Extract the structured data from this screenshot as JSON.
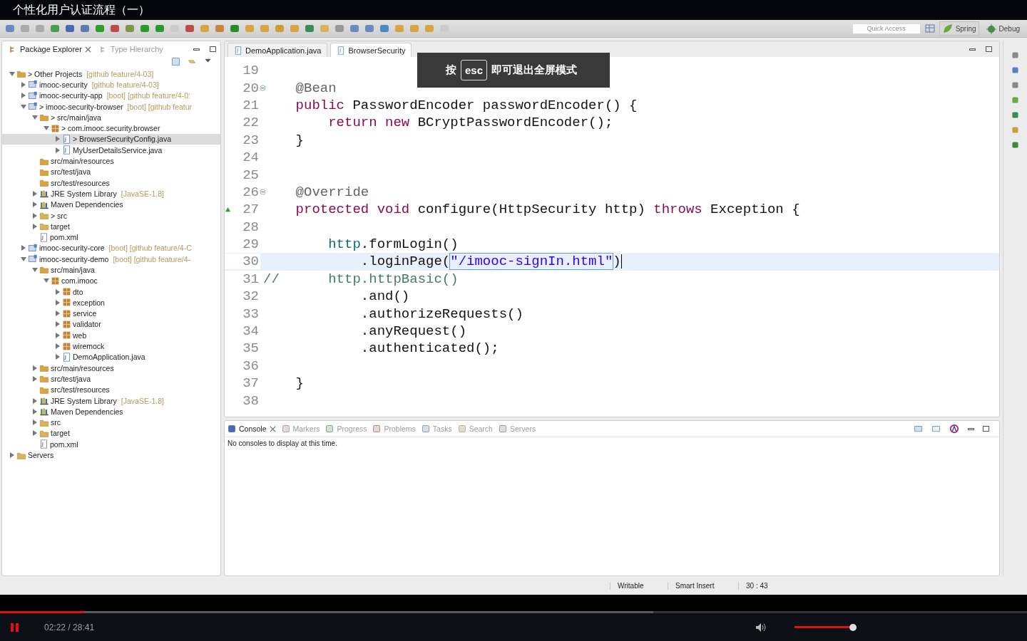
{
  "player": {
    "title": "个性化用户认证流程（一）",
    "played": {
      "level": 0.082
    },
    "buffered": {
      "level": 0.636
    },
    "paused": false,
    "time": "02:22 / 28:41",
    "volume": {
      "level": 1
    }
  },
  "toast": {
    "parts": [
      "按",
      "esc",
      "即可退出全屏模式"
    ]
  },
  "toolbar": {
    "quick_access": {
      "placeholder": "Quick Access"
    },
    "perspectives": [
      {
        "label": "Spring",
        "kind": "spring",
        "selected": true
      },
      {
        "label": "Debug",
        "kind": "debug",
        "selected": false
      }
    ]
  },
  "left_tabs": [
    {
      "label": "Package Explorer",
      "selected": true
    },
    {
      "label": "Type Hierarchy",
      "selected": false
    }
  ],
  "tree": [
    {
      "label": "> Other Projects",
      "decoration": "[github feature/4-03]",
      "kind": "workingset",
      "expanded": true,
      "selected": false,
      "children": [
        {
          "label": "imooc-security",
          "decoration": "[github feature/4-03]",
          "kind": "project",
          "expanded": false,
          "selected": false
        },
        {
          "label": "imooc-security-app",
          "decoration": "[boot]  [github feature/4-0:",
          "kind": "project",
          "expanded": false,
          "selected": false
        },
        {
          "label": "> imooc-security-browser",
          "decoration": "[boot]  [github featur",
          "kind": "project",
          "expanded": true,
          "selected": false,
          "children": [
            {
              "label": "> src/main/java",
              "kind": "srcroot",
              "expanded": true,
              "selected": false,
              "children": [
                {
                  "label": "> com.imooc.security.browser",
                  "kind": "package",
                  "expanded": true,
                  "selected": false,
                  "children": [
                    {
                      "label": "> BrowserSecurityConfig.java",
                      "kind": "java",
                      "expanded": false,
                      "selected": true
                    },
                    {
                      "label": "MyUserDetailsService.java",
                      "kind": "java",
                      "expanded": false,
                      "selected": false
                    }
                  ]
                }
              ]
            },
            {
              "label": "src/main/resources",
              "kind": "srcroot",
              "selected": false
            },
            {
              "label": "src/test/java",
              "kind": "srcroot",
              "selected": false
            },
            {
              "label": "src/test/resources",
              "kind": "srcroot",
              "selected": false
            },
            {
              "label": "JRE System Library",
              "decoration": "[JavaSE-1.8]",
              "kind": "library",
              "expanded": false,
              "selected": false
            },
            {
              "label": "Maven Dependencies",
              "kind": "library",
              "expanded": false,
              "selected": false
            },
            {
              "label": "> src",
              "kind": "folder",
              "expanded": false,
              "selected": false
            },
            {
              "label": "target",
              "kind": "folder",
              "expanded": false,
              "selected": false
            },
            {
              "label": "pom.xml",
              "kind": "xml",
              "selected": false
            }
          ]
        },
        {
          "label": "imooc-security-core",
          "decoration": "[boot]  [github feature/4-C",
          "kind": "project",
          "expanded": false,
          "selected": false
        },
        {
          "label": "imooc-security-demo",
          "decoration": "[boot]  [github feature/4-",
          "kind": "project",
          "expanded": true,
          "selected": false,
          "children": [
            {
              "label": "src/main/java",
              "kind": "srcroot",
              "expanded": true,
              "selected": false,
              "children": [
                {
                  "label": "com.imooc",
                  "kind": "package",
                  "expanded": true,
                  "selected": false,
                  "children": [
                    {
                      "label": "dto",
                      "kind": "package",
                      "expanded": false,
                      "selected": false
                    },
                    {
                      "label": "exception",
                      "kind": "package",
                      "expanded": false,
                      "selected": false
                    },
                    {
                      "label": "service",
                      "kind": "package",
                      "expanded": false,
                      "selected": false
                    },
                    {
                      "label": "validator",
                      "kind": "package",
                      "expanded": false,
                      "selected": false
                    },
                    {
                      "label": "web",
                      "kind": "package",
                      "expanded": false,
                      "selected": false
                    },
                    {
                      "label": "wiremock",
                      "kind": "package",
                      "expanded": false,
                      "selected": false
                    },
                    {
                      "label": "DemoApplication.java",
                      "kind": "java",
                      "expanded": false,
                      "selected": false
                    }
                  ]
                }
              ]
            },
            {
              "label": "src/main/resources",
              "kind": "srcroot",
              "expanded": false,
              "selected": false
            },
            {
              "label": "src/test/java",
              "kind": "srcroot",
              "expanded": false,
              "selected": false
            },
            {
              "label": "src/test/resources",
              "kind": "srcroot",
              "selected": false
            },
            {
              "label": "JRE System Library",
              "decoration": "[JavaSE-1.8]",
              "kind": "library",
              "expanded": false,
              "selected": false
            },
            {
              "label": "Maven Dependencies",
              "kind": "library",
              "expanded": false,
              "selected": false
            },
            {
              "label": "src",
              "kind": "folder",
              "expanded": false,
              "selected": false
            },
            {
              "label": "target",
              "kind": "folder",
              "expanded": false,
              "selected": false
            },
            {
              "label": "pom.xml",
              "kind": "xml",
              "selected": false
            }
          ]
        }
      ]
    },
    {
      "label": "Servers",
      "kind": "folder",
      "expanded": false,
      "selected": false
    }
  ],
  "editor_tabs": [
    {
      "label": "DemoApplication.java",
      "selected": false
    },
    {
      "label": "BrowserSecurity",
      "selected": true
    }
  ],
  "code": [
    {
      "number": "19",
      "kind": "plain",
      "current": false
    },
    {
      "number": "20",
      "kind": "fold",
      "current": false,
      "tokens": [
        {
          "kind": "annotation",
          "text": "    @Bean"
        }
      ]
    },
    {
      "number": "21",
      "kind": "plain",
      "current": false,
      "tokens": [
        {
          "kind": "keyword",
          "text": "    public"
        },
        {
          "kind": "plain",
          "text": " PasswordEncoder passwordEncoder() {"
        }
      ]
    },
    {
      "number": "22",
      "kind": "plain",
      "current": false,
      "tokens": [
        {
          "kind": "keyword",
          "text": "        return new"
        },
        {
          "kind": "plain",
          "text": " BCryptPasswordEncoder();"
        }
      ]
    },
    {
      "number": "23",
      "kind": "plain",
      "current": false,
      "tokens": [
        {
          "kind": "plain",
          "text": "    }"
        }
      ]
    },
    {
      "number": "24",
      "kind": "plain",
      "current": false
    },
    {
      "number": "25",
      "kind": "plain",
      "current": false
    },
    {
      "number": "26",
      "kind": "fold",
      "current": false,
      "tokens": [
        {
          "kind": "annotation",
          "text": "    @Override"
        }
      ]
    },
    {
      "number": "27",
      "kind": "override",
      "current": false,
      "tokens": [
        {
          "kind": "keyword",
          "text": "    protected void"
        },
        {
          "kind": "plain",
          "text": " configure(HttpSecurity http)"
        },
        {
          "kind": "keyword",
          "text": " throws"
        },
        {
          "kind": "plain",
          "text": " Exception {"
        }
      ]
    },
    {
      "number": "28",
      "kind": "plain",
      "current": false
    },
    {
      "number": "29",
      "kind": "plain",
      "current": false,
      "tokens": [
        {
          "kind": "field",
          "text": "        http"
        },
        {
          "kind": "plain",
          "text": ".formLogin()"
        }
      ]
    },
    {
      "number": "30",
      "kind": "plain",
      "current": true,
      "tokens": [
        {
          "kind": "plain",
          "text": "            .loginPage("
        },
        {
          "kind": "string",
          "text": "\"/imooc-signIn.html\""
        },
        {
          "kind": "plain",
          "text": ")"
        }
      ]
    },
    {
      "number": "31",
      "kind": "plain",
      "current": false,
      "tokens": [
        {
          "kind": "comment",
          "text": "//      http.httpBasic()"
        }
      ]
    },
    {
      "number": "32",
      "kind": "plain",
      "current": false,
      "tokens": [
        {
          "kind": "plain",
          "text": "            .and()"
        }
      ]
    },
    {
      "number": "33",
      "kind": "plain",
      "current": false,
      "tokens": [
        {
          "kind": "plain",
          "text": "            .authorizeRequests()"
        }
      ]
    },
    {
      "number": "34",
      "kind": "plain",
      "current": false,
      "tokens": [
        {
          "kind": "plain",
          "text": "            .anyRequest()"
        }
      ]
    },
    {
      "number": "35",
      "kind": "plain",
      "current": false,
      "tokens": [
        {
          "kind": "plain",
          "text": "            .authenticated();"
        }
      ]
    },
    {
      "number": "36",
      "kind": "plain",
      "current": false
    },
    {
      "number": "37",
      "kind": "plain",
      "current": false,
      "tokens": [
        {
          "kind": "plain",
          "text": "    }"
        }
      ]
    },
    {
      "number": "38",
      "kind": "plain",
      "current": false
    }
  ],
  "console_tabs": [
    {
      "label": "Console",
      "kind": "console",
      "selected": true
    },
    {
      "label": "Markers",
      "kind": "markers",
      "selected": false
    },
    {
      "label": "Progress",
      "kind": "progress",
      "selected": false
    },
    {
      "label": "Problems",
      "kind": "problems",
      "selected": false
    },
    {
      "label": "Tasks",
      "kind": "tasks",
      "selected": false
    },
    {
      "label": "Search",
      "kind": "search",
      "selected": false
    },
    {
      "label": "Servers",
      "kind": "servers",
      "selected": false
    }
  ],
  "console_message": "No consoles to display at this time.",
  "status_bar": [
    "Writable",
    "Smart Insert",
    "30 : 43"
  ]
}
